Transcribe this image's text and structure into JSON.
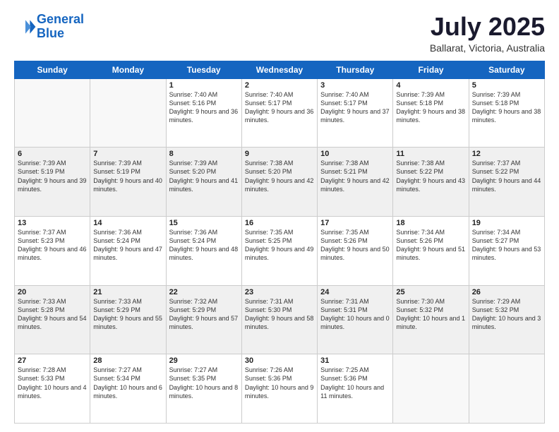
{
  "header": {
    "logo_line1": "General",
    "logo_line2": "Blue",
    "month_title": "July 2025",
    "location": "Ballarat, Victoria, Australia"
  },
  "weekdays": [
    "Sunday",
    "Monday",
    "Tuesday",
    "Wednesday",
    "Thursday",
    "Friday",
    "Saturday"
  ],
  "weeks": [
    [
      {
        "day": "",
        "sunrise": "",
        "sunset": "",
        "daylight": ""
      },
      {
        "day": "",
        "sunrise": "",
        "sunset": "",
        "daylight": ""
      },
      {
        "day": "1",
        "sunrise": "Sunrise: 7:40 AM",
        "sunset": "Sunset: 5:16 PM",
        "daylight": "Daylight: 9 hours and 36 minutes."
      },
      {
        "day": "2",
        "sunrise": "Sunrise: 7:40 AM",
        "sunset": "Sunset: 5:17 PM",
        "daylight": "Daylight: 9 hours and 36 minutes."
      },
      {
        "day": "3",
        "sunrise": "Sunrise: 7:40 AM",
        "sunset": "Sunset: 5:17 PM",
        "daylight": "Daylight: 9 hours and 37 minutes."
      },
      {
        "day": "4",
        "sunrise": "Sunrise: 7:39 AM",
        "sunset": "Sunset: 5:18 PM",
        "daylight": "Daylight: 9 hours and 38 minutes."
      },
      {
        "day": "5",
        "sunrise": "Sunrise: 7:39 AM",
        "sunset": "Sunset: 5:18 PM",
        "daylight": "Daylight: 9 hours and 38 minutes."
      }
    ],
    [
      {
        "day": "6",
        "sunrise": "Sunrise: 7:39 AM",
        "sunset": "Sunset: 5:19 PM",
        "daylight": "Daylight: 9 hours and 39 minutes."
      },
      {
        "day": "7",
        "sunrise": "Sunrise: 7:39 AM",
        "sunset": "Sunset: 5:19 PM",
        "daylight": "Daylight: 9 hours and 40 minutes."
      },
      {
        "day": "8",
        "sunrise": "Sunrise: 7:39 AM",
        "sunset": "Sunset: 5:20 PM",
        "daylight": "Daylight: 9 hours and 41 minutes."
      },
      {
        "day": "9",
        "sunrise": "Sunrise: 7:38 AM",
        "sunset": "Sunset: 5:20 PM",
        "daylight": "Daylight: 9 hours and 42 minutes."
      },
      {
        "day": "10",
        "sunrise": "Sunrise: 7:38 AM",
        "sunset": "Sunset: 5:21 PM",
        "daylight": "Daylight: 9 hours and 42 minutes."
      },
      {
        "day": "11",
        "sunrise": "Sunrise: 7:38 AM",
        "sunset": "Sunset: 5:22 PM",
        "daylight": "Daylight: 9 hours and 43 minutes."
      },
      {
        "day": "12",
        "sunrise": "Sunrise: 7:37 AM",
        "sunset": "Sunset: 5:22 PM",
        "daylight": "Daylight: 9 hours and 44 minutes."
      }
    ],
    [
      {
        "day": "13",
        "sunrise": "Sunrise: 7:37 AM",
        "sunset": "Sunset: 5:23 PM",
        "daylight": "Daylight: 9 hours and 46 minutes."
      },
      {
        "day": "14",
        "sunrise": "Sunrise: 7:36 AM",
        "sunset": "Sunset: 5:24 PM",
        "daylight": "Daylight: 9 hours and 47 minutes."
      },
      {
        "day": "15",
        "sunrise": "Sunrise: 7:36 AM",
        "sunset": "Sunset: 5:24 PM",
        "daylight": "Daylight: 9 hours and 48 minutes."
      },
      {
        "day": "16",
        "sunrise": "Sunrise: 7:35 AM",
        "sunset": "Sunset: 5:25 PM",
        "daylight": "Daylight: 9 hours and 49 minutes."
      },
      {
        "day": "17",
        "sunrise": "Sunrise: 7:35 AM",
        "sunset": "Sunset: 5:26 PM",
        "daylight": "Daylight: 9 hours and 50 minutes."
      },
      {
        "day": "18",
        "sunrise": "Sunrise: 7:34 AM",
        "sunset": "Sunset: 5:26 PM",
        "daylight": "Daylight: 9 hours and 51 minutes."
      },
      {
        "day": "19",
        "sunrise": "Sunrise: 7:34 AM",
        "sunset": "Sunset: 5:27 PM",
        "daylight": "Daylight: 9 hours and 53 minutes."
      }
    ],
    [
      {
        "day": "20",
        "sunrise": "Sunrise: 7:33 AM",
        "sunset": "Sunset: 5:28 PM",
        "daylight": "Daylight: 9 hours and 54 minutes."
      },
      {
        "day": "21",
        "sunrise": "Sunrise: 7:33 AM",
        "sunset": "Sunset: 5:29 PM",
        "daylight": "Daylight: 9 hours and 55 minutes."
      },
      {
        "day": "22",
        "sunrise": "Sunrise: 7:32 AM",
        "sunset": "Sunset: 5:29 PM",
        "daylight": "Daylight: 9 hours and 57 minutes."
      },
      {
        "day": "23",
        "sunrise": "Sunrise: 7:31 AM",
        "sunset": "Sunset: 5:30 PM",
        "daylight": "Daylight: 9 hours and 58 minutes."
      },
      {
        "day": "24",
        "sunrise": "Sunrise: 7:31 AM",
        "sunset": "Sunset: 5:31 PM",
        "daylight": "Daylight: 10 hours and 0 minutes."
      },
      {
        "day": "25",
        "sunrise": "Sunrise: 7:30 AM",
        "sunset": "Sunset: 5:32 PM",
        "daylight": "Daylight: 10 hours and 1 minute."
      },
      {
        "day": "26",
        "sunrise": "Sunrise: 7:29 AM",
        "sunset": "Sunset: 5:32 PM",
        "daylight": "Daylight: 10 hours and 3 minutes."
      }
    ],
    [
      {
        "day": "27",
        "sunrise": "Sunrise: 7:28 AM",
        "sunset": "Sunset: 5:33 PM",
        "daylight": "Daylight: 10 hours and 4 minutes."
      },
      {
        "day": "28",
        "sunrise": "Sunrise: 7:27 AM",
        "sunset": "Sunset: 5:34 PM",
        "daylight": "Daylight: 10 hours and 6 minutes."
      },
      {
        "day": "29",
        "sunrise": "Sunrise: 7:27 AM",
        "sunset": "Sunset: 5:35 PM",
        "daylight": "Daylight: 10 hours and 8 minutes."
      },
      {
        "day": "30",
        "sunrise": "Sunrise: 7:26 AM",
        "sunset": "Sunset: 5:36 PM",
        "daylight": "Daylight: 10 hours and 9 minutes."
      },
      {
        "day": "31",
        "sunrise": "Sunrise: 7:25 AM",
        "sunset": "Sunset: 5:36 PM",
        "daylight": "Daylight: 10 hours and 11 minutes."
      },
      {
        "day": "",
        "sunrise": "",
        "sunset": "",
        "daylight": ""
      },
      {
        "day": "",
        "sunrise": "",
        "sunset": "",
        "daylight": ""
      }
    ]
  ]
}
